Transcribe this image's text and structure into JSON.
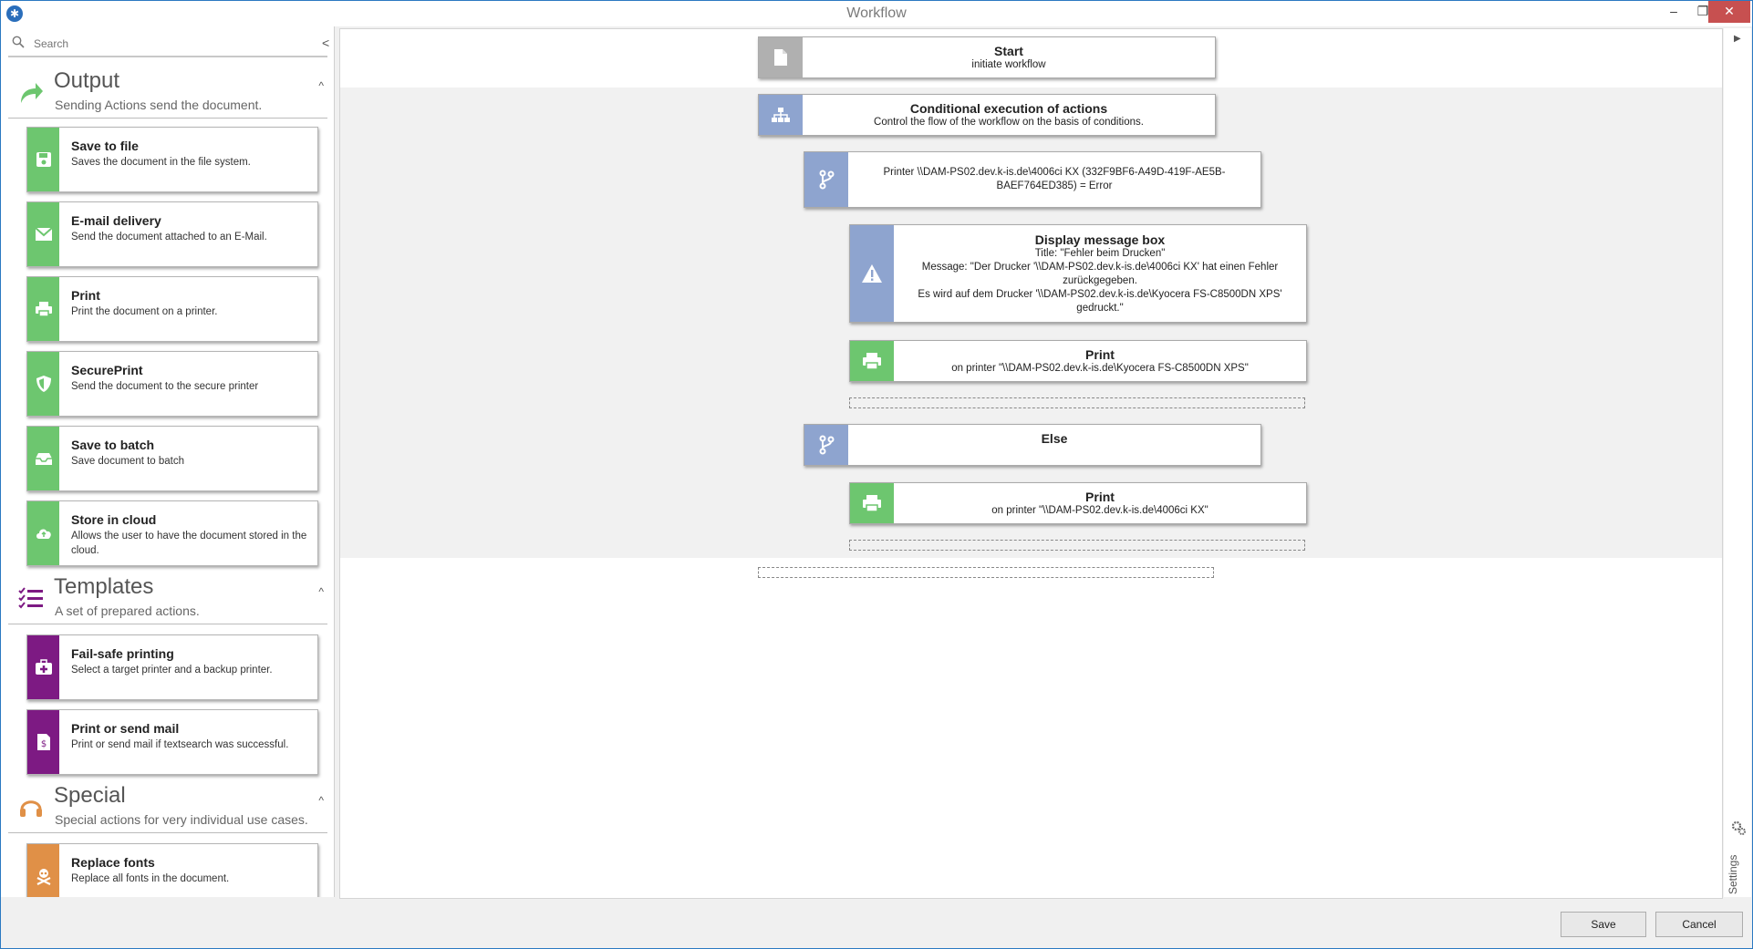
{
  "window": {
    "title": "Workflow",
    "minimize": "–",
    "restore": "❐",
    "close": "✕"
  },
  "search": {
    "placeholder": "Search",
    "collapse": "<"
  },
  "sections": [
    {
      "title": "Output",
      "subtitle": "Sending Actions send the document.",
      "chevron": "^"
    },
    {
      "title": "Templates",
      "subtitle": "A set of prepared actions.",
      "chevron": "^"
    },
    {
      "title": "Special",
      "subtitle": "Special actions for very individual use cases.",
      "chevron": "^"
    }
  ],
  "output_items": [
    {
      "title": "Save to file",
      "desc": "Saves the document in the file system."
    },
    {
      "title": "E-mail delivery",
      "desc": "Send the document attached to an E-Mail."
    },
    {
      "title": "Print",
      "desc": "Print the document on a printer."
    },
    {
      "title": "SecurePrint",
      "desc": "Send the document to the secure printer"
    },
    {
      "title": "Save to batch",
      "desc": "Save document to batch"
    },
    {
      "title": "Store in cloud",
      "desc": "Allows the user to have the document stored in the cloud."
    }
  ],
  "template_items": [
    {
      "title": "Fail-safe printing",
      "desc": "Select a target printer and a backup printer."
    },
    {
      "title": "Print or send mail",
      "desc": "Print or send mail if textsearch was successful."
    }
  ],
  "special_items": [
    {
      "title": "Replace fonts",
      "desc": "Replace all fonts in the document."
    }
  ],
  "workflow": {
    "start": {
      "title": "Start",
      "text": "initiate workflow"
    },
    "conditional": {
      "title": "Conditional execution of actions",
      "text": "Control the flow of the workflow on the basis of conditions."
    },
    "condition": {
      "text": "Printer \\\\DAM-PS02.dev.k-is.de\\4006ci KX (332F9BF6-A49D-419F-AE5B-\nBAEF764ED385) = Error"
    },
    "message": {
      "title": "Display message box",
      "text": "Title: \"Fehler beim Drucken\"\nMessage: \"Der Drucker '\\\\DAM-PS02.dev.k-is.de\\4006ci KX' hat einen Fehler\nzurückgegeben.\nEs wird auf dem Drucker '\\\\DAM-PS02.dev.k-is.de\\Kyocera FS-C8500DN XPS'\ngedruckt.\""
    },
    "print1": {
      "title": "Print",
      "text": "on printer \"\\\\DAM-PS02.dev.k-is.de\\Kyocera FS-C8500DN XPS\""
    },
    "else": {
      "title": "Else"
    },
    "print2": {
      "title": "Print",
      "text": "on printer \"\\\\DAM-PS02.dev.k-is.de\\4006ci KX\""
    }
  },
  "right": {
    "expand": "▶",
    "settings": "Settings"
  },
  "buttons": {
    "save": "Save",
    "cancel": "Cancel"
  },
  "colors": {
    "accent_green": "#6dc66f",
    "accent_blue": "#8ea4cf",
    "accent_purple": "#7d1a83",
    "accent_orange": "#e09047",
    "close_red": "#c75050"
  }
}
